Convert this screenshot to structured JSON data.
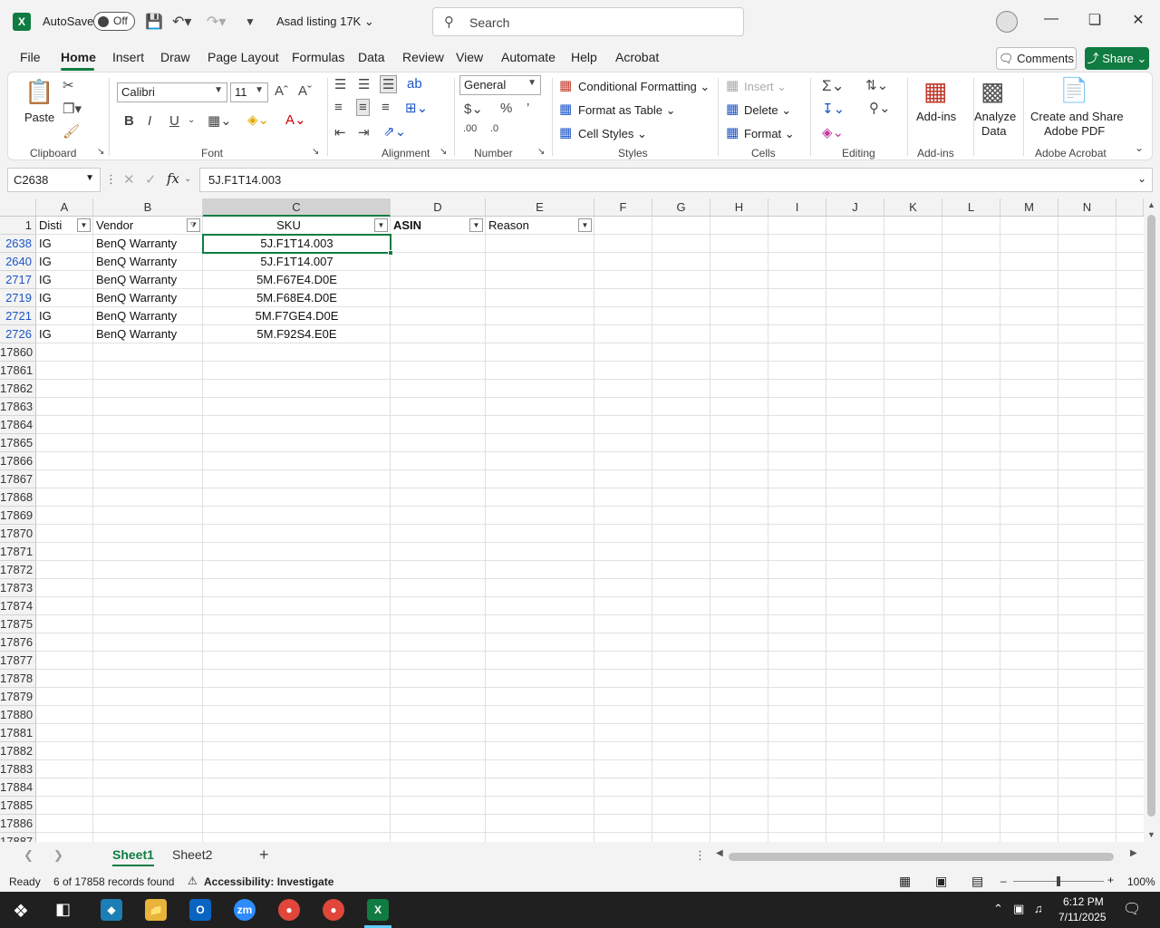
{
  "titlebar": {
    "autosave_label": "AutoSave",
    "autosave_state": "Off",
    "doc_title": "Asad listing 17K",
    "search_placeholder": "Search"
  },
  "menu": {
    "items": [
      "File",
      "Home",
      "Insert",
      "Draw",
      "Page Layout",
      "Formulas",
      "Data",
      "Review",
      "View",
      "Automate",
      "Help",
      "Acrobat"
    ],
    "active": "Home",
    "comments": "Comments",
    "share": "Share"
  },
  "ribbon": {
    "clipboard": {
      "paste": "Paste",
      "label": "Clipboard"
    },
    "font": {
      "name": "Calibri",
      "size": "11",
      "label": "Font"
    },
    "alignment": {
      "label": "Alignment"
    },
    "number": {
      "format": "General",
      "label": "Number"
    },
    "styles": {
      "conditional": "Conditional Formatting",
      "format_table": "Format as Table",
      "cell_styles": "Cell Styles",
      "label": "Styles"
    },
    "cells": {
      "insert": "Insert",
      "delete": "Delete",
      "format": "Format",
      "label": "Cells"
    },
    "editing": {
      "label": "Editing"
    },
    "addins": {
      "btn": "Add-ins",
      "label": "Add-ins"
    },
    "analyze": {
      "line1": "Analyze",
      "line2": "Data"
    },
    "acrobat": {
      "line1": "Create and Share",
      "line2": "Adobe PDF",
      "label": "Adobe Acrobat"
    }
  },
  "formula_bar": {
    "name_box": "C2638",
    "formula": "5J.F1T14.003"
  },
  "grid": {
    "columns": [
      "A",
      "B",
      "C",
      "D",
      "E",
      "F",
      "G",
      "H",
      "I",
      "J",
      "K",
      "L",
      "M",
      "N"
    ],
    "headers": {
      "A": "Disti",
      "B": "Vendor",
      "C": "SKU",
      "D": "ASIN",
      "E": "Reason"
    },
    "rows": [
      {
        "num": "2638",
        "disti": "IG",
        "vendor": "BenQ Warranty",
        "sku": "5J.F1T14.003"
      },
      {
        "num": "2640",
        "disti": "IG",
        "vendor": "BenQ Warranty",
        "sku": "5J.F1T14.007"
      },
      {
        "num": "2717",
        "disti": "IG",
        "vendor": "BenQ Warranty",
        "sku": "5M.F67E4.D0E"
      },
      {
        "num": "2719",
        "disti": "IG",
        "vendor": "BenQ Warranty",
        "sku": "5M.F68E4.D0E"
      },
      {
        "num": "2721",
        "disti": "IG",
        "vendor": "BenQ Warranty",
        "sku": "5M.F7GE4.D0E"
      },
      {
        "num": "2726",
        "disti": "IG",
        "vendor": "BenQ Warranty",
        "sku": "5M.F92S4.E0E"
      }
    ],
    "empty_rows": [
      "17860",
      "17861",
      "17862",
      "17863",
      "17864",
      "17865",
      "17866",
      "17867",
      "17868",
      "17869",
      "17870",
      "17871",
      "17872",
      "17873",
      "17874",
      "17875",
      "17876",
      "17877",
      "17878",
      "17879",
      "17880",
      "17881",
      "17882",
      "17883",
      "17884",
      "17885",
      "17886",
      "17887"
    ],
    "header_row_num": "1"
  },
  "sheets": {
    "tabs": [
      "Sheet1",
      "Sheet2"
    ],
    "active": "Sheet1"
  },
  "status": {
    "ready": "Ready",
    "records": "6 of 17858 records found",
    "accessibility": "Accessibility: Investigate",
    "zoom": "100%"
  },
  "taskbar": {
    "time": "6:12 PM",
    "date": "7/11/2025"
  }
}
